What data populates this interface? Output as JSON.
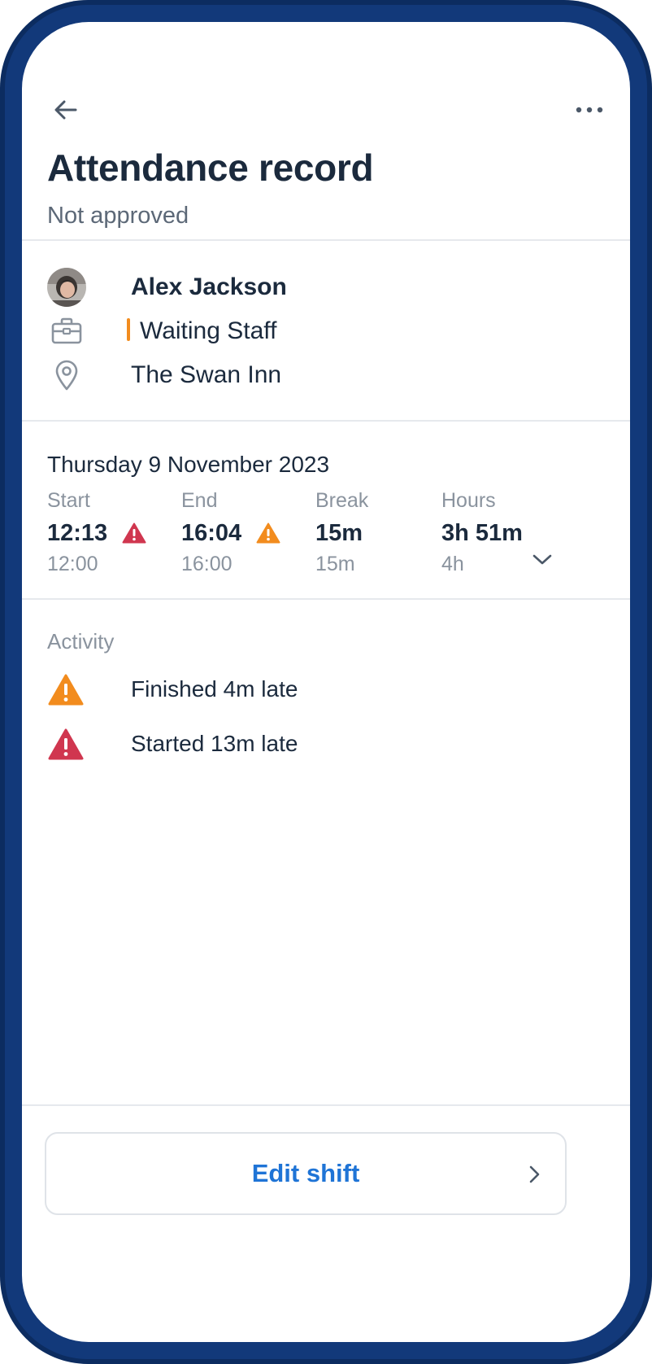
{
  "header": {
    "title": "Attendance record",
    "status": "Not approved"
  },
  "employee": {
    "name": "Alex Jackson",
    "role": "Waiting Staff",
    "location": "The Swan Inn",
    "role_color": "#f28c1e"
  },
  "shift": {
    "date": "Thursday 9 November 2023",
    "columns": [
      {
        "label": "Start",
        "actual": "12:13",
        "scheduled": "12:00",
        "warning": "red"
      },
      {
        "label": "End",
        "actual": "16:04",
        "scheduled": "16:00",
        "warning": "orange"
      },
      {
        "label": "Break",
        "actual": "15m",
        "scheduled": "15m"
      },
      {
        "label": "Hours",
        "actual": "3h 51m",
        "scheduled": "4h"
      }
    ]
  },
  "activity": {
    "label": "Activity",
    "items": [
      {
        "text": "Finished 4m late",
        "icon": "warning-orange-icon"
      },
      {
        "text": "Started 13m late",
        "icon": "warning-red-icon"
      }
    ]
  },
  "footer": {
    "edit_label": "Edit shift"
  },
  "colors": {
    "warning_red": "#d0364f",
    "warning_orange": "#f28c1e",
    "accent_blue": "#1f74d6",
    "frame": "#0c2c60"
  }
}
